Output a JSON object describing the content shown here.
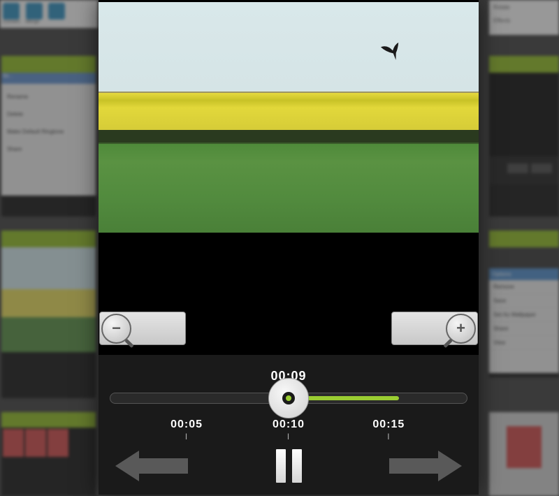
{
  "background": {
    "toolbar_left": [
      "Convert",
      "Merge",
      "..."
    ],
    "topright": [
      "Rotate",
      "Effects"
    ],
    "context_menu_1": {
      "title_row": "file...",
      "items": [
        "Rename",
        "Delete",
        "Make Default Ringtone",
        "Share"
      ]
    },
    "context_menu_2": {
      "header": "Options",
      "items": [
        "Remove",
        "Save",
        "Set As Wallpaper",
        "Share",
        "View"
      ]
    }
  },
  "player": {
    "current_time": "00:09",
    "progress_ratio": 0.5,
    "markers": [
      {
        "label": "00:05",
        "pos": 0.215
      },
      {
        "label": "00:10",
        "pos": 0.5
      },
      {
        "label": "00:15",
        "pos": 0.78
      }
    ],
    "zoom_out_symbol": "−",
    "zoom_in_symbol": "+"
  }
}
